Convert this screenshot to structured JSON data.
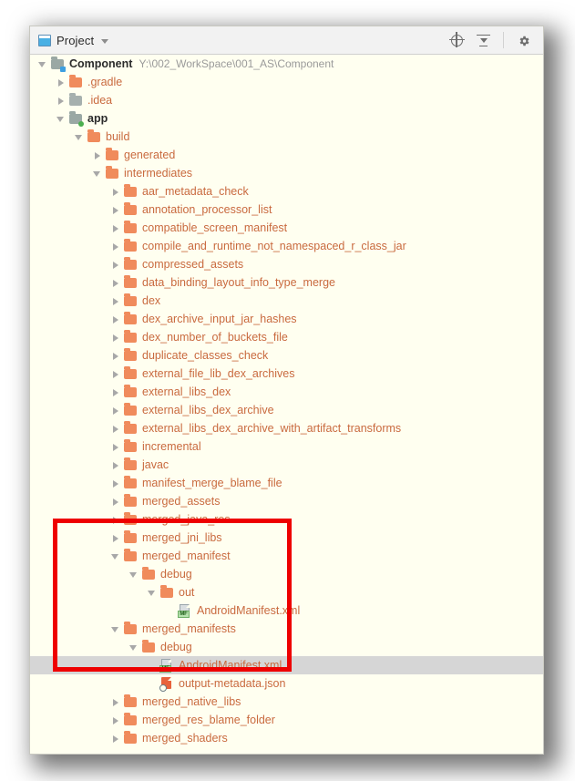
{
  "window": {
    "title": "Project",
    "panel_icon": "project-panel-icon",
    "dropdown_icon": "chevron-down-icon"
  },
  "toolbar": {
    "buttons": [
      {
        "name": "select-opened-file-button",
        "icon": "target-icon",
        "label": "Select Opened File"
      },
      {
        "name": "collapse-all-button",
        "icon": "collapse-all-icon",
        "label": "Collapse All"
      },
      {
        "name": "settings-button",
        "icon": "gear-icon",
        "label": "Settings"
      }
    ]
  },
  "annotation": {
    "color": "#ee0000",
    "shape": "rectangle"
  },
  "colors": {
    "panel_background": "#fffff0",
    "folder_orange": "#f08b5c",
    "folder_gray": "#a6b0ae",
    "text_orange": "#c96a3f",
    "selection": "#d6d6d6",
    "highlight_red": "#ee0000"
  },
  "tree": {
    "root_path": "Y:\\002_WorkSpace\\001_AS\\Component",
    "nodes": [
      {
        "label": "Component",
        "path": "Y:\\002_WorkSpace\\001_AS\\Component",
        "depth": 0,
        "state": "open",
        "icon": "module-icon-blue",
        "style": "dark-bold"
      },
      {
        "label": ".gradle",
        "depth": 1,
        "state": "closed",
        "icon": "folder-orange"
      },
      {
        "label": ".idea",
        "depth": 1,
        "state": "closed",
        "icon": "folder-gray"
      },
      {
        "label": "app",
        "depth": 1,
        "state": "open",
        "icon": "module-icon-green",
        "style": "dark-bold"
      },
      {
        "label": "build",
        "depth": 2,
        "state": "open",
        "icon": "folder-orange"
      },
      {
        "label": "generated",
        "depth": 3,
        "state": "closed",
        "icon": "folder-orange"
      },
      {
        "label": "intermediates",
        "depth": 3,
        "state": "open",
        "icon": "folder-orange"
      },
      {
        "label": "aar_metadata_check",
        "depth": 4,
        "state": "closed",
        "icon": "folder-orange"
      },
      {
        "label": "annotation_processor_list",
        "depth": 4,
        "state": "closed",
        "icon": "folder-orange"
      },
      {
        "label": "compatible_screen_manifest",
        "depth": 4,
        "state": "closed",
        "icon": "folder-orange"
      },
      {
        "label": "compile_and_runtime_not_namespaced_r_class_jar",
        "depth": 4,
        "state": "closed",
        "icon": "folder-orange"
      },
      {
        "label": "compressed_assets",
        "depth": 4,
        "state": "closed",
        "icon": "folder-orange"
      },
      {
        "label": "data_binding_layout_info_type_merge",
        "depth": 4,
        "state": "closed",
        "icon": "folder-orange"
      },
      {
        "label": "dex",
        "depth": 4,
        "state": "closed",
        "icon": "folder-orange"
      },
      {
        "label": "dex_archive_input_jar_hashes",
        "depth": 4,
        "state": "closed",
        "icon": "folder-orange"
      },
      {
        "label": "dex_number_of_buckets_file",
        "depth": 4,
        "state": "closed",
        "icon": "folder-orange"
      },
      {
        "label": "duplicate_classes_check",
        "depth": 4,
        "state": "closed",
        "icon": "folder-orange"
      },
      {
        "label": "external_file_lib_dex_archives",
        "depth": 4,
        "state": "closed",
        "icon": "folder-orange"
      },
      {
        "label": "external_libs_dex",
        "depth": 4,
        "state": "closed",
        "icon": "folder-orange"
      },
      {
        "label": "external_libs_dex_archive",
        "depth": 4,
        "state": "closed",
        "icon": "folder-orange"
      },
      {
        "label": "external_libs_dex_archive_with_artifact_transforms",
        "depth": 4,
        "state": "closed",
        "icon": "folder-orange"
      },
      {
        "label": "incremental",
        "depth": 4,
        "state": "closed",
        "icon": "folder-orange"
      },
      {
        "label": "javac",
        "depth": 4,
        "state": "closed",
        "icon": "folder-orange"
      },
      {
        "label": "manifest_merge_blame_file",
        "depth": 4,
        "state": "closed",
        "icon": "folder-orange"
      },
      {
        "label": "merged_assets",
        "depth": 4,
        "state": "closed",
        "icon": "folder-orange"
      },
      {
        "label": "merged_java_res",
        "depth": 4,
        "state": "closed",
        "icon": "folder-orange"
      },
      {
        "label": "merged_jni_libs",
        "depth": 4,
        "state": "closed",
        "icon": "folder-orange"
      },
      {
        "label": "merged_manifest",
        "depth": 4,
        "state": "open",
        "icon": "folder-orange"
      },
      {
        "label": "debug",
        "depth": 5,
        "state": "open",
        "icon": "folder-orange"
      },
      {
        "label": "out",
        "depth": 6,
        "state": "open",
        "icon": "folder-orange"
      },
      {
        "label": "AndroidManifest.xml",
        "depth": 7,
        "state": "leaf",
        "icon": "manifest-file-icon"
      },
      {
        "label": "merged_manifests",
        "depth": 4,
        "state": "open",
        "icon": "folder-orange"
      },
      {
        "label": "debug",
        "depth": 5,
        "state": "open",
        "icon": "folder-orange"
      },
      {
        "label": "AndroidManifest.xml",
        "depth": 6,
        "state": "leaf",
        "icon": "manifest-file-icon",
        "selected": true
      },
      {
        "label": "output-metadata.json",
        "depth": 6,
        "state": "leaf",
        "icon": "json-file-icon"
      },
      {
        "label": "merged_native_libs",
        "depth": 4,
        "state": "closed",
        "icon": "folder-orange"
      },
      {
        "label": "merged_res_blame_folder",
        "depth": 4,
        "state": "closed",
        "icon": "folder-orange"
      },
      {
        "label": "merged_shaders",
        "depth": 4,
        "state": "closed",
        "icon": "folder-orange"
      }
    ]
  }
}
